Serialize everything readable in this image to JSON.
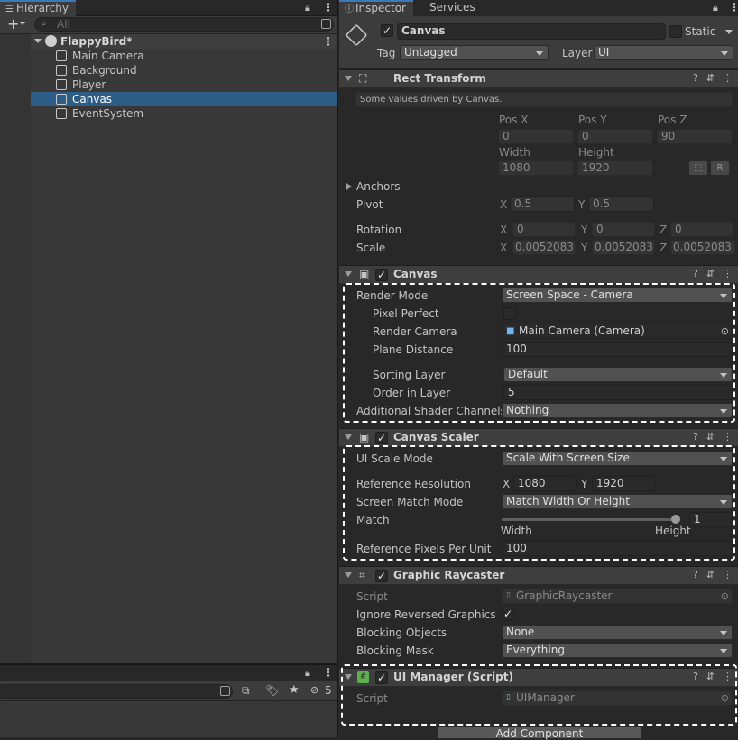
{
  "hierarchy": {
    "tab": "Hierarchy",
    "search_placeholder": "All",
    "scene": "FlappyBird*",
    "items": [
      "Main Camera",
      "Background",
      "Player",
      "Canvas",
      "EventSystem"
    ],
    "selected_index": 3
  },
  "bottom_panel": {
    "hidden_count": "5"
  },
  "inspector": {
    "tabs": [
      "Inspector",
      "Services"
    ],
    "object_name": "Canvas",
    "static_label": "Static",
    "tag_label": "Tag",
    "tag_value": "Untagged",
    "layer_label": "Layer",
    "layer_value": "UI",
    "rect_transform": {
      "title": "Rect Transform",
      "note": "Some values driven by Canvas.",
      "pos_x_label": "Pos X",
      "pos_y_label": "Pos Y",
      "pos_z_label": "Pos Z",
      "pos_x": "0",
      "pos_y": "0",
      "pos_z": "90",
      "width_label": "Width",
      "height_label": "Height",
      "width": "1080",
      "height": "1920",
      "anchors_label": "Anchors",
      "pivot_label": "Pivot",
      "pivot_x": "0.5",
      "pivot_y": "0.5",
      "rotation_label": "Rotation",
      "rot_x": "0",
      "rot_y": "0",
      "rot_z": "0",
      "scale_label": "Scale",
      "scale_x": "0.0052083",
      "scale_y": "0.0052083",
      "scale_z": "0.0052083",
      "axis_x": "X",
      "axis_y": "Y",
      "axis_z": "Z",
      "r_button": "R"
    },
    "canvas": {
      "title": "Canvas",
      "render_mode_label": "Render Mode",
      "render_mode": "Screen Space - Camera",
      "pixel_perfect_label": "Pixel Perfect",
      "render_camera_label": "Render Camera",
      "render_camera": "Main Camera (Camera)",
      "plane_distance_label": "Plane Distance",
      "plane_distance": "100",
      "sorting_layer_label": "Sorting Layer",
      "sorting_layer": "Default",
      "order_label": "Order in Layer",
      "order": "5",
      "shader_channels_label": "Additional Shader Channels",
      "shader_channels": "Nothing"
    },
    "canvas_scaler": {
      "title": "Canvas Scaler",
      "scale_mode_label": "UI Scale Mode",
      "scale_mode": "Scale With Screen Size",
      "ref_res_label": "Reference Resolution",
      "ref_x": "1080",
      "ref_y": "1920",
      "match_mode_label": "Screen Match Mode",
      "match_mode": "Match Width Or Height",
      "match_label": "Match",
      "match_value": "1",
      "match_fraction": 1,
      "width_caption": "Width",
      "height_caption": "Height",
      "ppu_label": "Reference Pixels Per Unit",
      "ppu": "100"
    },
    "graphic_raycaster": {
      "title": "Graphic Raycaster",
      "script_label": "Script",
      "script": "GraphicRaycaster",
      "ignore_reversed_label": "Ignore Reversed Graphics",
      "blocking_objects_label": "Blocking Objects",
      "blocking_objects": "None",
      "blocking_mask_label": "Blocking Mask",
      "blocking_mask": "Everything"
    },
    "ui_manager": {
      "title": "UI Manager (Script)",
      "script_label": "Script",
      "script": "UIManager"
    },
    "add_component": "Add Component"
  },
  "colors": {
    "selection": "#2c5d87",
    "tab_accent": "#3a79bb",
    "highlight_dash": "#ffffff"
  }
}
